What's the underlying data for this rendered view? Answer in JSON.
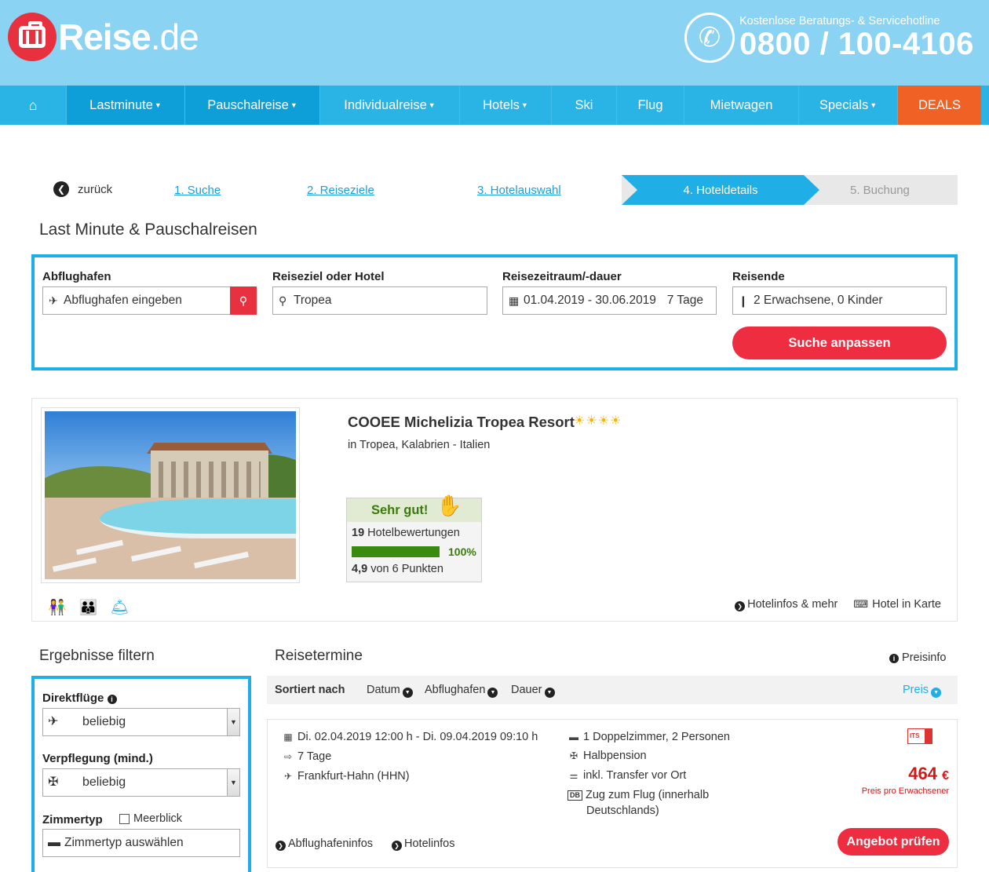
{
  "brand": {
    "logo_main": "Reise",
    "logo_tld": ".de"
  },
  "hotline": {
    "label": "Kostenlose Beratungs- & Servicehotline",
    "number": "0800 / 100-4106"
  },
  "nav": {
    "items": [
      {
        "label": "Lastminute",
        "caret": true
      },
      {
        "label": "Pauschalreise",
        "caret": true
      },
      {
        "label": "Individualreise",
        "caret": true
      },
      {
        "label": "Hotels",
        "caret": true
      },
      {
        "label": "Ski",
        "caret": false
      },
      {
        "label": "Flug",
        "caret": false
      },
      {
        "label": "Mietwagen",
        "caret": false
      },
      {
        "label": "Specials",
        "caret": true
      },
      {
        "label": "DEALS",
        "caret": false
      }
    ]
  },
  "steps": {
    "back": "zurück",
    "items": [
      "1. Suche",
      "2. Reiseziele",
      "3. Hotelauswahl",
      "4. Hoteldetails",
      "5. Buchung"
    ]
  },
  "search": {
    "title": "Last Minute & Pauschalreisen",
    "departure_label": "Abflughafen",
    "departure_placeholder": "Abflughafen eingeben",
    "destination_label": "Reiseziel oder Hotel",
    "destination_value": "Tropea",
    "period_label": "Reisezeitraum/-dauer",
    "period_value": "01.04.2019 - 30.06.2019",
    "duration_value": "7 Tage",
    "travellers_label": "Reisende",
    "travellers_value": "2 Erwachsene, 0 Kinder",
    "submit": "Suche anpassen"
  },
  "hotel": {
    "name": "COOEE Michelizia Tropea Resort",
    "stars": 4,
    "location": "in Tropea, Kalabrien - Italien",
    "rating": {
      "verdict": "Sehr gut!",
      "review_count": "19",
      "review_label": "Hotelbewertungen",
      "recommend_fraction": 1.0,
      "recommend_text": "100%",
      "score": "4,9",
      "score_suffix": "von 6 Punkten"
    },
    "links": {
      "info": "Hotelinfos & mehr",
      "map": "Hotel in Karte"
    }
  },
  "filter": {
    "title": "Ergebnisse filtern",
    "direct_label": "Direktflüge",
    "direct_value": "beliebig",
    "board_label": "Verpflegung (mind.)",
    "board_value": "beliebig",
    "room_label": "Zimmertyp",
    "seaview_label": "Meerblick",
    "room_placeholder": "Zimmertyp auswählen"
  },
  "results": {
    "title": "Reisetermine",
    "price_info": "Preisinfo",
    "sort_label": "Sortiert nach",
    "sort_options": [
      "Datum",
      "Abflughafen",
      "Dauer"
    ],
    "sort_active": "Preis",
    "offer": {
      "dates": "Di. 02.04.2019 12:00 h - Di. 09.04.2019 09:10 h",
      "duration": "7 Tage",
      "airport": "Frankfurt-Hahn (HHN)",
      "room": "1 Doppelzimmer, 2 Personen",
      "board": "Halbpension",
      "transfer": "inkl. Transfer vor Ort",
      "train_badge": "DB",
      "train_line1": "Zug zum Flug (innerhalb",
      "train_line2": "Deutschlands)",
      "operator": "ITS",
      "price": "464",
      "currency": "€",
      "price_note": "Preis pro Erwachsener",
      "cta": "Angebot prüfen",
      "link_airport": "Abflughafeninfos",
      "link_hotel": "Hotelinfos"
    }
  }
}
